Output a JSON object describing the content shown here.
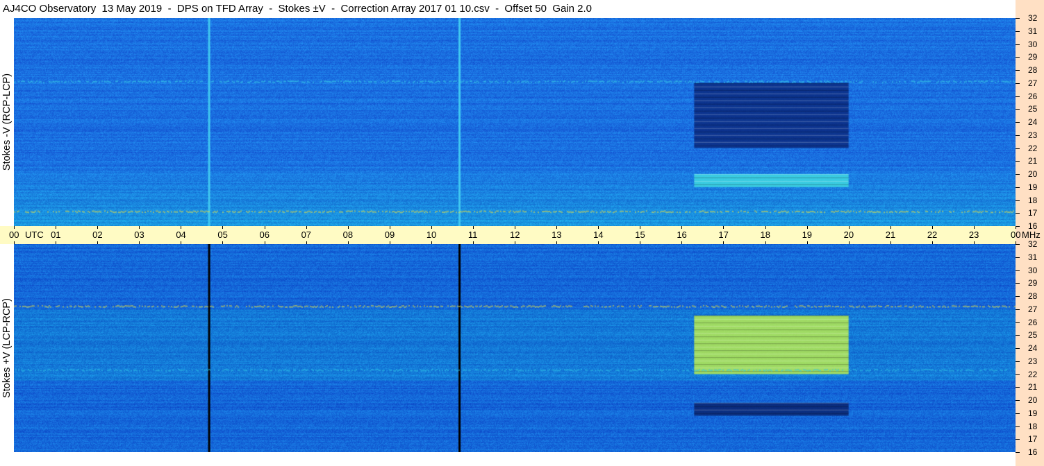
{
  "title": "AJ4CO Observatory  13 May 2019  -  DPS on TFD Array  -  Stokes ±V  -  Correction Array 2017 01 10.csv  -  Offset 50  Gain 2.0",
  "chart_data": {
    "type": "heatmap",
    "x_axis": {
      "unit_label": "UTC",
      "range_hours": [
        0,
        24
      ],
      "ticks": [
        "00",
        "01",
        "02",
        "03",
        "04",
        "05",
        "06",
        "07",
        "08",
        "09",
        "10",
        "11",
        "12",
        "13",
        "14",
        "15",
        "16",
        "17",
        "18",
        "19",
        "20",
        "21",
        "22",
        "23",
        "00"
      ]
    },
    "y_axis": {
      "unit_label": "MHz",
      "range_mhz": [
        16,
        32
      ],
      "ticks": [
        "32",
        "31",
        "30",
        "29",
        "28",
        "27",
        "26",
        "25",
        "24",
        "23",
        "22",
        "21",
        "20",
        "19",
        "18",
        "17",
        "16"
      ]
    },
    "panels": [
      {
        "ylabel": "Stokes -V (RCP-LCP)",
        "colors": {
          "background": "#1a6fe0",
          "dark_block": "#0a2a80",
          "bright_band": "#3fe0e8",
          "hot_line": "#f0e030"
        },
        "events": [
          {
            "kind": "vertical-line",
            "utc_hours": 4.67,
            "color": "#40c8f0"
          },
          {
            "kind": "vertical-line",
            "utc_hours": 10.67,
            "color": "#40c8f0"
          },
          {
            "kind": "burst-block",
            "utc_start": 16.3,
            "utc_end": 20.0,
            "mhz_low": 22.0,
            "mhz_high": 27.0,
            "color": "#0a2a80"
          },
          {
            "kind": "burst-block",
            "utc_start": 16.3,
            "utc_end": 20.0,
            "mhz_low": 19.0,
            "mhz_high": 20.0,
            "color": "#40d8e0"
          },
          {
            "kind": "horizontal-band",
            "mhz": 17.1,
            "color": "#e8e040"
          },
          {
            "kind": "horizontal-band",
            "mhz": 27.1,
            "color": "#38d0e8"
          }
        ]
      },
      {
        "ylabel": "Stokes +V (LCP-RCP)",
        "colors": {
          "background": "#1466d8",
          "bright_block": "#b8ec50",
          "dark_band": "#0a2570",
          "cyan_band": "#30c8e8"
        },
        "events": [
          {
            "kind": "vertical-line",
            "utc_hours": 4.67,
            "color": "#000000"
          },
          {
            "kind": "vertical-line",
            "utc_hours": 10.67,
            "color": "#000000"
          },
          {
            "kind": "burst-block",
            "utc_start": 16.3,
            "utc_end": 20.0,
            "mhz_low": 22.0,
            "mhz_high": 26.5,
            "color": "#b8ec50"
          },
          {
            "kind": "burst-block",
            "utc_start": 16.3,
            "utc_end": 20.0,
            "mhz_low": 18.8,
            "mhz_high": 19.8,
            "color": "#0a2570"
          },
          {
            "kind": "horizontal-band",
            "mhz": 27.2,
            "color": "#e8e040"
          },
          {
            "kind": "horizontal-band",
            "mhz": 22.3,
            "color": "#30c8e8"
          }
        ]
      }
    ]
  }
}
